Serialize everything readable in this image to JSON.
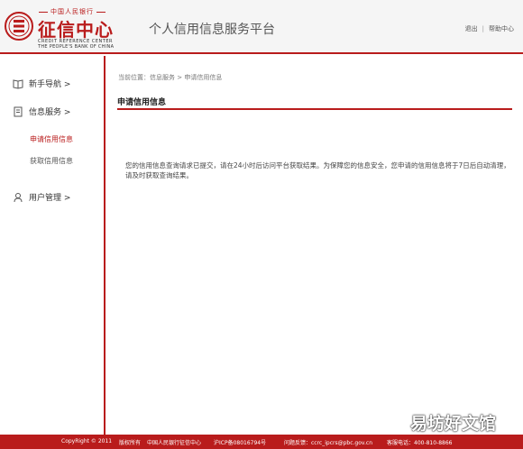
{
  "header": {
    "logo_top": "中国人民银行",
    "logo_main": "征信中心",
    "logo_en_1": "CREDIT REFERENCE CENTER",
    "logo_en_2": "THE PEOPLE'S BANK OF CHINA",
    "site_title": "个人信用信息服务平台",
    "logout": "退出",
    "separator": "|",
    "help": "帮助中心"
  },
  "sidebar": {
    "guide": "新手导航 >",
    "credit_service": "信息服务 >",
    "sub_apply": "申请信用信息",
    "sub_get": "获取信用信息",
    "user_mgmt": "用户管理 >"
  },
  "main": {
    "breadcrumb": "当前位置：信息服务 > 申请信用信息",
    "section_title": "申请信用信息",
    "message": "您的信用信息查询请求已提交，请在24小时后访问平台获取结果。为保障您的信息安全，您申请的信用信息将于7日后自动清理，请及时获取查询结果。"
  },
  "footer": {
    "copyright": "CopyRight © 2011",
    "rights": "版权所有",
    "owner": "中国人民银行征信中心",
    "icp": "沪ICP备08016794号",
    "feedback": "问题反馈：ccrc_ipcrs@pbc.gov.cn",
    "hotline": "客服电话：400-810-8866"
  },
  "watermark": "易坊好文馆",
  "colors": {
    "accent": "#b91c1c"
  }
}
